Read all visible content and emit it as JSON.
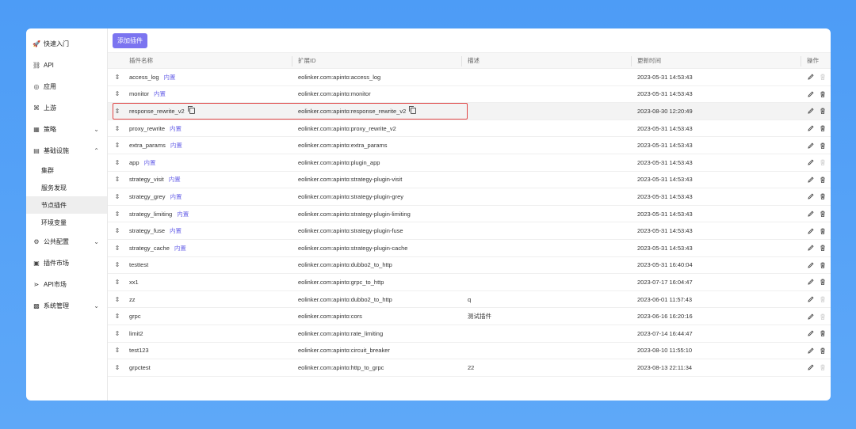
{
  "sidebar": {
    "items": [
      {
        "label": "快速入门",
        "icon": "rocket-icon",
        "glyph": "🚀"
      },
      {
        "label": "API",
        "icon": "link-icon",
        "glyph": "⛓"
      },
      {
        "label": "应用",
        "icon": "app-icon",
        "glyph": "◎"
      },
      {
        "label": "上游",
        "icon": "upstream-icon",
        "glyph": "⌘"
      },
      {
        "label": "策略",
        "icon": "strategy-icon",
        "glyph": "▦",
        "chevron": "⌄"
      },
      {
        "label": "基础设施",
        "icon": "infrastructure-icon",
        "glyph": "▤",
        "chevron": "⌃"
      }
    ],
    "sub_items": [
      {
        "label": "集群"
      },
      {
        "label": "服务发现"
      },
      {
        "label": "节点插件"
      },
      {
        "label": "环境变量"
      }
    ],
    "items2": [
      {
        "label": "公共配置",
        "icon": "config-icon",
        "glyph": "⚙",
        "chevron": "⌄"
      },
      {
        "label": "插件市场",
        "icon": "plugin-market-icon",
        "glyph": "▣"
      },
      {
        "label": "API市场",
        "icon": "api-market-icon",
        "glyph": "⋗"
      },
      {
        "label": "系统管理",
        "icon": "system-icon",
        "glyph": "▩",
        "chevron": "⌄"
      }
    ]
  },
  "toolbar": {
    "add_label": "添加插件"
  },
  "table": {
    "headers": {
      "name": "插件名称",
      "id": "扩展ID",
      "desc": "描述",
      "time": "更新时间",
      "ops": "操作"
    },
    "drag_glyph": "⇕",
    "builtin_label": "内置",
    "rows": [
      {
        "name": "access_log",
        "builtin": true,
        "id": "eolinker.com:apinto:access_log",
        "desc": "",
        "time": "2023-05-31 14:53:43",
        "deletable": false
      },
      {
        "name": "monitor",
        "builtin": true,
        "id": "eolinker.com:apinto:monitor",
        "desc": "",
        "time": "2023-05-31 14:53:43",
        "deletable": true
      },
      {
        "name": "response_rewrite_v2",
        "builtin": false,
        "copy": true,
        "id": "eolinker.com:apinto:response_rewrite_v2",
        "desc": "",
        "time": "2023-08-30 12:20:49",
        "deletable": true,
        "highlight": true
      },
      {
        "name": "proxy_rewrite",
        "builtin": true,
        "id": "eolinker.com:apinto:proxy_rewrite_v2",
        "desc": "",
        "time": "2023-05-31 14:53:43",
        "deletable": true
      },
      {
        "name": "extra_params",
        "builtin": true,
        "id": "eolinker.com:apinto:extra_params",
        "desc": "",
        "time": "2023-05-31 14:53:43",
        "deletable": true
      },
      {
        "name": "app",
        "builtin": true,
        "id": "eolinker.com:apinto:plugin_app",
        "desc": "",
        "time": "2023-05-31 14:53:43",
        "deletable": false
      },
      {
        "name": "strategy_visit",
        "builtin": true,
        "id": "eolinker.com:apinto:strategy-plugin-visit",
        "desc": "",
        "time": "2023-05-31 14:53:43",
        "deletable": true
      },
      {
        "name": "strategy_grey",
        "builtin": true,
        "id": "eolinker.com:apinto:strategy-plugin-grey",
        "desc": "",
        "time": "2023-05-31 14:53:43",
        "deletable": true
      },
      {
        "name": "strategy_limiting",
        "builtin": true,
        "id": "eolinker.com:apinto:strategy-plugin-limiting",
        "desc": "",
        "time": "2023-05-31 14:53:43",
        "deletable": true
      },
      {
        "name": "strategy_fuse",
        "builtin": true,
        "id": "eolinker.com:apinto:strategy-plugin-fuse",
        "desc": "",
        "time": "2023-05-31 14:53:43",
        "deletable": true
      },
      {
        "name": "strategy_cache",
        "builtin": true,
        "id": "eolinker.com:apinto:strategy-plugin-cache",
        "desc": "",
        "time": "2023-05-31 14:53:43",
        "deletable": true
      },
      {
        "name": "testtest",
        "builtin": false,
        "id": "eolinker.com:apinto:dubbo2_to_http",
        "desc": "",
        "time": "2023-05-31 16:40:04",
        "deletable": true
      },
      {
        "name": "xx1",
        "builtin": false,
        "id": "eolinker.com:apinto:grpc_to_http",
        "desc": "",
        "time": "2023-07-17 16:04:47",
        "deletable": true
      },
      {
        "name": "zz",
        "builtin": false,
        "id": "eolinker.com:apinto:dubbo2_to_http",
        "desc": "q",
        "time": "2023-06-01 11:57:43",
        "deletable": false
      },
      {
        "name": "grpc",
        "builtin": false,
        "id": "eolinker.com:apinto:cors",
        "desc": "测试插件",
        "time": "2023-06-16 16:20:16",
        "deletable": false
      },
      {
        "name": "limit2",
        "builtin": false,
        "id": "eolinker.com:apinto:rate_limiting",
        "desc": "",
        "time": "2023-07-14 16:44:47",
        "deletable": true
      },
      {
        "name": "test123",
        "builtin": false,
        "id": "eolinker.com:apinto:circuit_breaker",
        "desc": "",
        "time": "2023-08-10 11:55:10",
        "deletable": true
      },
      {
        "name": "grpctest",
        "builtin": false,
        "id": "eolinker.com:apinto:http_to_grpc",
        "desc": "22",
        "time": "2023-08-13 22:11:34",
        "deletable": false
      }
    ]
  },
  "colors": {
    "accent": "#7b74f0",
    "builtin": "#6a64e8",
    "highlight_border": "#e04545",
    "background": "#4d9cf6"
  }
}
